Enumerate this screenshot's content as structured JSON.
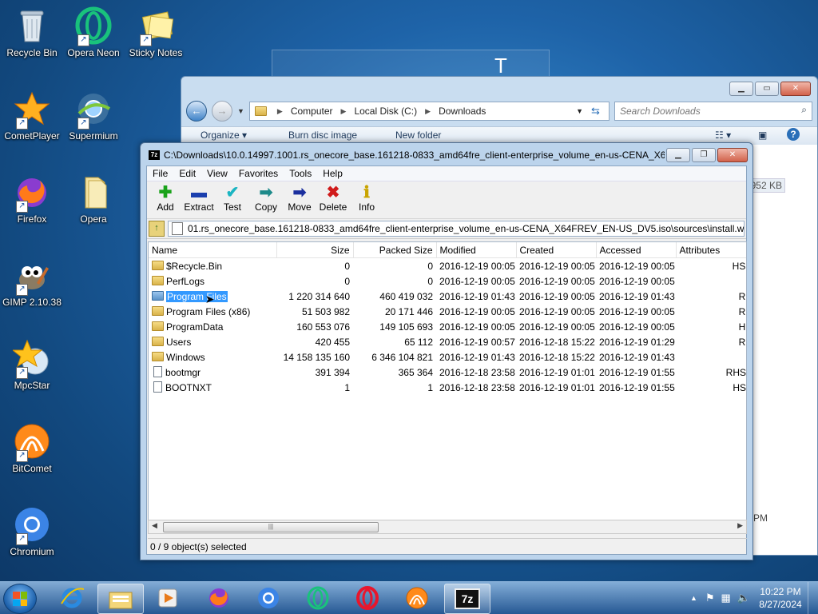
{
  "desktop": {
    "icons": [
      {
        "label": "Recycle Bin"
      },
      {
        "label": "Opera Neon"
      },
      {
        "label": "Sticky Notes"
      },
      {
        "label": "CometPlayer"
      },
      {
        "label": "Supermium"
      },
      {
        "label": "Firefox"
      },
      {
        "label": "Opera"
      },
      {
        "label": "GIMP 2.10.38"
      },
      {
        "label": "MpcStar"
      },
      {
        "label": "BitComet"
      },
      {
        "label": "Chromium"
      }
    ],
    "banner_text": "T Z"
  },
  "explorer": {
    "breadcrumb": [
      "Computer",
      "Local Disk (C:)",
      "Downloads"
    ],
    "search_placeholder": "Search Downloads",
    "toolbar": {
      "organize": "Organize ▾",
      "burn": "Burn disc image",
      "new_folder": "New folder"
    },
    "size_hint": "952 KB",
    "time_hint": "PM"
  },
  "sevenzip": {
    "title": "C:\\Downloads\\10.0.14997.1001.rs_onecore_base.161218-0833_amd64fre_client-enterprise_volume_en-us-CENA_X64FR...",
    "menu": [
      "File",
      "Edit",
      "View",
      "Favorites",
      "Tools",
      "Help"
    ],
    "tools": [
      {
        "label": "Add",
        "glyph": "✚",
        "color": "#1aa31a"
      },
      {
        "label": "Extract",
        "glyph": "▬",
        "color": "#1b3fae"
      },
      {
        "label": "Test",
        "glyph": "✔",
        "color": "#1bb5c2"
      },
      {
        "label": "Copy",
        "glyph": "➡",
        "color": "#1d8a8a"
      },
      {
        "label": "Move",
        "glyph": "➡",
        "color": "#1b2f9e"
      },
      {
        "label": "Delete",
        "glyph": "✖",
        "color": "#d01b1b"
      },
      {
        "label": "Info",
        "glyph": "ℹ",
        "color": "#c9a400"
      }
    ],
    "path": "01.rs_onecore_base.161218-0833_amd64fre_client-enterprise_volume_en-us-CENA_X64FREV_EN-US_DV5.iso\\sources\\install.wim\\",
    "columns": [
      "Name",
      "Size",
      "Packed Size",
      "Modified",
      "Created",
      "Accessed",
      "Attributes"
    ],
    "rows": [
      {
        "name": "$Recycle.Bin",
        "size": "0",
        "packed": "0",
        "modified": "2016-12-19 00:05",
        "created": "2016-12-19 00:05",
        "accessed": "2016-12-19 00:05",
        "attr": "HSD",
        "type": "folder"
      },
      {
        "name": "PerfLogs",
        "size": "0",
        "packed": "0",
        "modified": "2016-12-19 00:05",
        "created": "2016-12-19 00:05",
        "accessed": "2016-12-19 00:05",
        "attr": "D",
        "type": "folder"
      },
      {
        "name": "Program Files",
        "size": "1 220 314 640",
        "packed": "460 419 032",
        "modified": "2016-12-19 01:43",
        "created": "2016-12-19 00:05",
        "accessed": "2016-12-19 01:43",
        "attr": "RD",
        "type": "folder",
        "selected": true
      },
      {
        "name": "Program Files (x86)",
        "size": "51 503 982",
        "packed": "20 171 446",
        "modified": "2016-12-19 00:05",
        "created": "2016-12-19 00:05",
        "accessed": "2016-12-19 00:05",
        "attr": "RD",
        "type": "folder"
      },
      {
        "name": "ProgramData",
        "size": "160 553 076",
        "packed": "149 105 693",
        "modified": "2016-12-19 00:05",
        "created": "2016-12-19 00:05",
        "accessed": "2016-12-19 00:05",
        "attr": "HD",
        "type": "folder"
      },
      {
        "name": "Users",
        "size": "420 455",
        "packed": "65 112",
        "modified": "2016-12-19 00:57",
        "created": "2016-12-18 15:22",
        "accessed": "2016-12-19 01:29",
        "attr": "RD",
        "type": "folder"
      },
      {
        "name": "Windows",
        "size": "14 158 135 160",
        "packed": "6 346 104 821",
        "modified": "2016-12-19 01:43",
        "created": "2016-12-18 15:22",
        "accessed": "2016-12-19 01:43",
        "attr": "D",
        "type": "folder"
      },
      {
        "name": "bootmgr",
        "size": "391 394",
        "packed": "365 364",
        "modified": "2016-12-18 23:58",
        "created": "2016-12-19 01:01",
        "accessed": "2016-12-19 01:55",
        "attr": "RHSA",
        "type": "file"
      },
      {
        "name": "BOOTNXT",
        "size": "1",
        "packed": "1",
        "modified": "2016-12-18 23:58",
        "created": "2016-12-19 01:01",
        "accessed": "2016-12-19 01:55",
        "attr": "HSA",
        "type": "file"
      }
    ],
    "status": "0 / 9 object(s) selected"
  },
  "taskbar": {
    "time": "10:22 PM",
    "date": "8/27/2024"
  }
}
